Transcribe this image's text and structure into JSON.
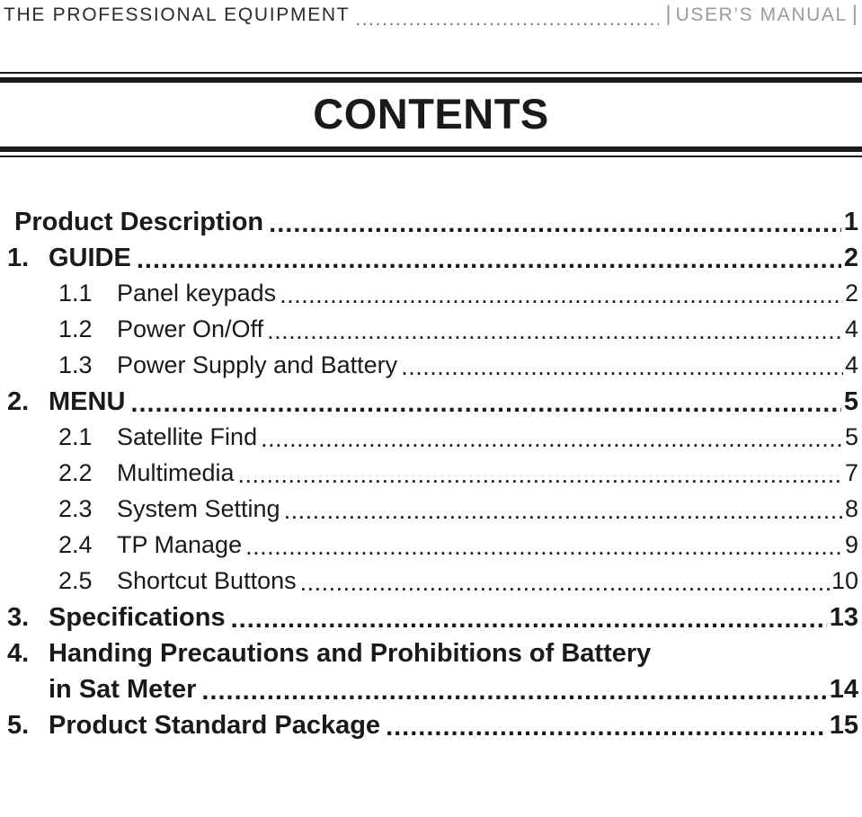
{
  "header": {
    "title": "THE PROFESSIONAL EQUIPMENT",
    "leader": "..................................................................",
    "separator_left": "|",
    "separator_right": "|",
    "manual_label": "USER’S MANUAL",
    "accent_gray": "#9b9b9b"
  },
  "page_title": "CONTENTS",
  "rules": {
    "color": "#1a1a1a"
  },
  "toc": {
    "leader_dots": "..................................................................................................................................",
    "entries": [
      {
        "level": 0,
        "number": "",
        "label": "Product Description",
        "page": "1"
      },
      {
        "level": 1,
        "number": "1.",
        "label": "GUIDE",
        "page": "2"
      },
      {
        "level": 2,
        "number": "1.1",
        "label": "Panel keypads",
        "page": "2"
      },
      {
        "level": 2,
        "number": "1.2",
        "label": "Power On/Off",
        "page": "4"
      },
      {
        "level": 2,
        "number": "1.3",
        "label": "Power Supply and Battery",
        "page": "4"
      },
      {
        "level": 1,
        "number": "2.",
        "label": "MENU",
        "page": "5"
      },
      {
        "level": 2,
        "number": "2.1",
        "label": "Satellite Find",
        "page": "5"
      },
      {
        "level": 2,
        "number": "2.2",
        "label": "Multimedia",
        "page": "7"
      },
      {
        "level": 2,
        "number": "2.3",
        "label": "System Setting",
        "page": "8"
      },
      {
        "level": 2,
        "number": "2.4",
        "label": "TP Manage",
        "page": "9"
      },
      {
        "level": 2,
        "number": "2.5",
        "label": "Shortcut Buttons",
        "page": "10"
      },
      {
        "level": 1,
        "number": "3.",
        "label": "Specifications",
        "page": "13"
      },
      {
        "level": 1,
        "number": "4.",
        "label": "Handing Precautions and Prohibitions of Battery",
        "page": ""
      },
      {
        "level": 1,
        "number": "",
        "label": "in Sat Meter",
        "page": "14",
        "wrap": true
      },
      {
        "level": 1,
        "number": "5.",
        "label": "Product Standard Package",
        "page": "15"
      }
    ]
  }
}
